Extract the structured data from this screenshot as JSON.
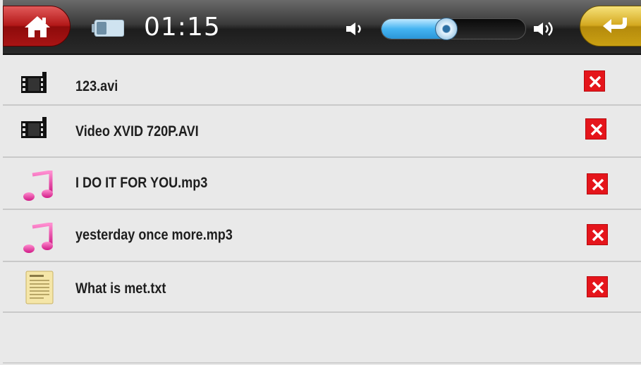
{
  "status_bar": {
    "clock": "01:15",
    "volume_fraction": 0.45,
    "home_icon": "home-icon",
    "battery_icon": "battery-icon",
    "volume_down_icon": "volume-low-icon",
    "volume_up_icon": "volume-high-icon",
    "back_icon": "back-arrow-icon"
  },
  "colors": {
    "home_button": "#b31818",
    "back_button": "#d4a81f",
    "volume_fill": "#45b4f2",
    "delete_button": "#e5151b"
  },
  "files": [
    {
      "name": "123.avi",
      "type": "video",
      "icon": "film-icon",
      "delete_icon": "delete-icon"
    },
    {
      "name": "Video XVID 720P.AVI",
      "type": "video",
      "icon": "film-icon",
      "delete_icon": "delete-icon"
    },
    {
      "name": "I DO IT FOR YOU.mp3",
      "type": "audio",
      "icon": "music-note-icon",
      "delete_icon": "delete-icon"
    },
    {
      "name": "yesterday once more.mp3",
      "type": "audio",
      "icon": "music-note-icon",
      "delete_icon": "delete-icon"
    },
    {
      "name": "What is met.txt",
      "type": "text",
      "icon": "text-file-icon",
      "delete_icon": "delete-icon"
    }
  ]
}
